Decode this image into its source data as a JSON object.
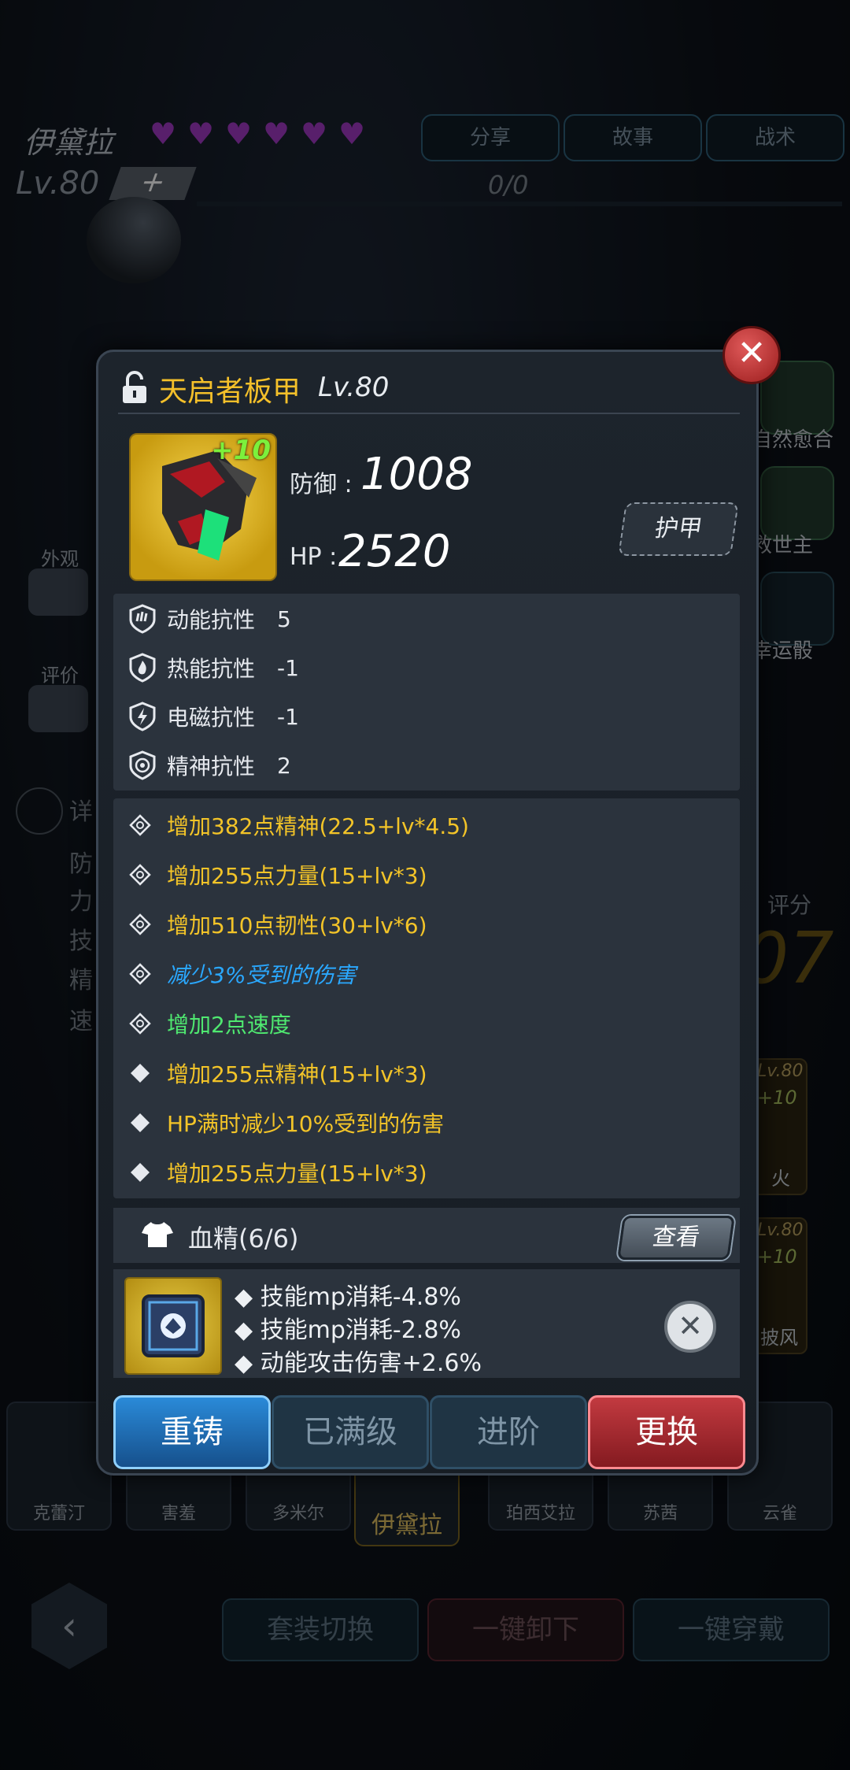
{
  "hero": {
    "name": "伊黛拉",
    "level": "Lv.80",
    "plus": "+",
    "exp": "0/0",
    "tabs": [
      "分享",
      "故事",
      "战术"
    ],
    "side_labels": {
      "outfit": "外观",
      "review": "评价"
    },
    "detail_label": "详",
    "detail_rows": [
      "防",
      "力",
      "技",
      "精",
      "速"
    ],
    "score_label": "评分",
    "score_value": "07",
    "skills": [
      "自然愈合",
      "救世主",
      "幸运骰"
    ],
    "mini_cards": [
      {
        "lv": "Lv.80",
        "plus": "+10",
        "name": "火"
      },
      {
        "lv": "Lv.80",
        "plus": "+10",
        "name": "披风"
      }
    ],
    "roster": [
      "克蕾汀",
      "害羞",
      "多米尔",
      "伊黛拉",
      "珀西艾拉",
      "苏茜",
      "云雀"
    ],
    "bottom_buttons": [
      "套装切换",
      "一键卸下",
      "一键穿戴"
    ],
    "back_icon": "chevron-left-icon"
  },
  "popup": {
    "close_icon": "close-icon",
    "lock_icon": "unlocked-padlock-icon",
    "title": "天启者板甲",
    "title_level": "Lv.80",
    "enhance": "+10",
    "defense_label": "防御 :",
    "defense_value": "1008",
    "hp_label": "HP :",
    "hp_value": "2520",
    "type_tag": "护甲",
    "resistances": [
      {
        "icon": "kinetic-shield-icon",
        "label": "动能抗性",
        "value": "5"
      },
      {
        "icon": "fire-shield-icon",
        "label": "热能抗性",
        "value": "-1"
      },
      {
        "icon": "lightning-shield-icon",
        "label": "电磁抗性",
        "value": "-1"
      },
      {
        "icon": "spiral-shield-icon",
        "label": "精神抗性",
        "value": "2"
      }
    ],
    "attributes": [
      {
        "bullet": "crosshair-diamond-icon",
        "text": "增加382点精神(22.5+lv*4.5)",
        "color": "gold"
      },
      {
        "bullet": "crosshair-diamond-icon",
        "text": "增加255点力量(15+lv*3)",
        "color": "gold"
      },
      {
        "bullet": "crosshair-diamond-icon",
        "text": "增加510点韧性(30+lv*6)",
        "color": "gold"
      },
      {
        "bullet": "crosshair-diamond-icon",
        "text": "减少3%受到的伤害",
        "color": "blue"
      },
      {
        "bullet": "crosshair-diamond-icon",
        "text": "增加2点速度",
        "color": "green"
      },
      {
        "bullet": "diamond-icon",
        "text": "增加255点精神(15+lv*3)",
        "color": "gold"
      },
      {
        "bullet": "diamond-icon",
        "text": "HP满时减少10%受到的伤害",
        "color": "gold"
      },
      {
        "bullet": "diamond-icon",
        "text": "增加255点力量(15+lv*3)",
        "color": "gold"
      }
    ],
    "blood_essence": {
      "icon": "tshirt-icon",
      "label": "血精(6/6)",
      "view_button": "查看"
    },
    "chip": {
      "icon": "chip-icon",
      "lines": [
        "◆ 技能mp消耗-4.8%",
        "◆ 技能mp消耗-2.8%",
        "◆ 动能攻击伤害+2.6%"
      ],
      "remove_icon": "remove-x-icon"
    },
    "actions": [
      "重铸",
      "已满级",
      "进阶",
      "更换"
    ],
    "colors": {
      "gold": "#f3c428",
      "blue": "#2aa8ff",
      "green": "#4fe870",
      "recast": "#1f6fb8",
      "replace": "#a8262c"
    }
  }
}
